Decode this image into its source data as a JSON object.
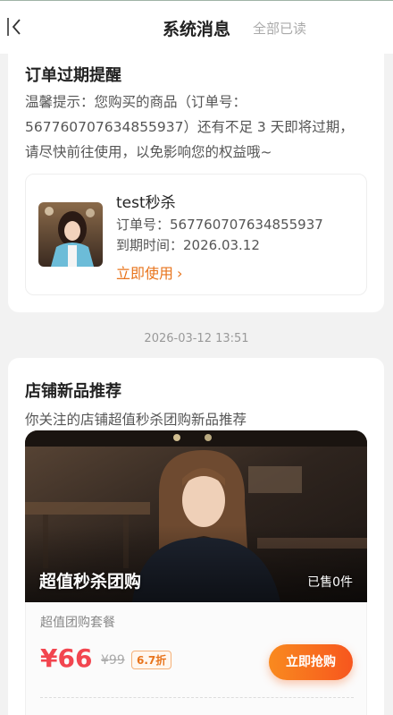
{
  "header": {
    "title": "系统消息",
    "read_all": "全部已读"
  },
  "expiry_card": {
    "title": "订单过期提醒",
    "description": "温馨提示：您购买的商品（订单号：567760707634855937）还有不足 3 天即将过期，请尽快前往使用，以免影响您的权益哦~",
    "order": {
      "name": "test秒杀",
      "order_no": "订单号：567760707634855937",
      "expiry": "到期时间：2026.03.12",
      "use_label": "立即使用",
      "chevron": "›"
    }
  },
  "timestamp": "2026-03-12 13:51",
  "recommend_card": {
    "title": "店铺新品推荐",
    "description": "你关注的店铺超值秒杀团购新品推荐",
    "promo": {
      "banner_title": "超值秒杀团购",
      "sold": "已售0件",
      "name": "超值团购套餐",
      "price": "¥66",
      "original_price": "¥99",
      "discount": "6.7折",
      "buy_label": "立即抢购"
    }
  },
  "colors": {
    "accent_orange": "#e8741c",
    "price_red": "#f2454f",
    "button_gradient_start": "#f98a1f",
    "button_gradient_end": "#f7561e"
  }
}
